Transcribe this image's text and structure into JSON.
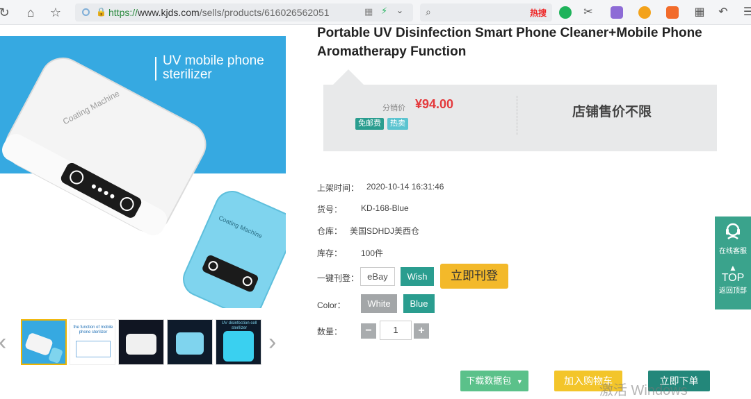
{
  "browser": {
    "url_scheme": "https://",
    "url_host": "www.kjds.com",
    "url_path": "/sells/products/616026562051",
    "search_hot": "热搜",
    "search_placeholder": ""
  },
  "product": {
    "title": "Portable UV Disinfection Smart Phone Cleaner+Mobile Phone Aromatherapy Function",
    "image_headline": "UV mobile phone sterilizer",
    "device_label": "Coating Machine",
    "thumb_caption": "the function of mobile phone sterilizer",
    "thumb_title_5": "UV disinfection cell sterilizer"
  },
  "price_panel": {
    "label": "分销价",
    "value": "¥94.00",
    "badges": [
      "免邮费",
      "热卖"
    ],
    "store_price": "店铺售价不限"
  },
  "info": {
    "listed_label": "上架时间：",
    "listed_value": "2020-10-14 16:31:46",
    "sku_label": "货号：",
    "sku_value": "KD-168-Blue",
    "warehouse_label": "仓库：",
    "warehouse_value": "美国SDHDJ美西仓",
    "stock_label": "库存：",
    "stock_value": "100件",
    "publish_label": "一键刊登：",
    "ebay_label": "eBay",
    "wish_label": "Wish",
    "publish_now": "立即刊登",
    "color_label": "Color：",
    "color_options": [
      "White",
      "Blue"
    ],
    "qty_label": "数量：",
    "qty_value": "1",
    "qty_minus": "−",
    "qty_plus": "+"
  },
  "actions": {
    "download": "下载数据包",
    "add_cart": "加入购物车",
    "order_now": "立即下单"
  },
  "side": {
    "service": "在线客服",
    "top": "TOP",
    "back_top": "返回顶部"
  },
  "watermark": "激活 Windows",
  "colors": {
    "accent_teal": "#2a9d8f",
    "price_red": "#e4393c",
    "publish_yellow": "#f3b92a",
    "image_blue": "#36a9e1"
  }
}
